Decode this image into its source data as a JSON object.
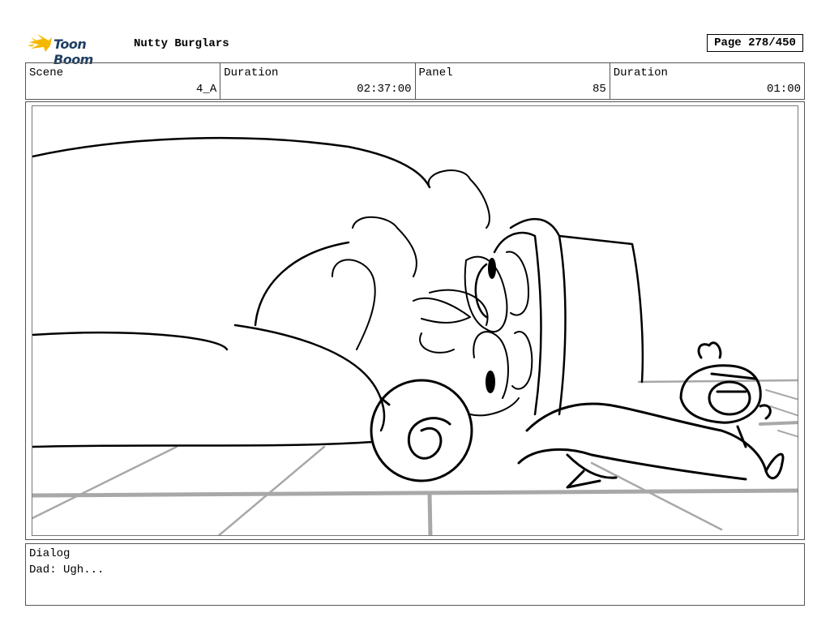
{
  "header": {
    "logo_text": "Toon Boom",
    "project_title": "Nutty Burglars",
    "page_label": "Page 278/450"
  },
  "info": {
    "scene_label": "Scene",
    "scene_value": "4_A",
    "duration_label": "Duration",
    "duration_value": "02:37:00",
    "panel_label": "Panel",
    "panel_value": "85",
    "panel_duration_label": "Duration",
    "panel_duration_value": "01:00"
  },
  "dialog": {
    "label": "Dialog",
    "text": "Dad: Ugh..."
  },
  "colors": {
    "logo_blue": "#1f3f63",
    "logo_yellow": "#f5b800",
    "floor_grey": "#a8a8a8"
  }
}
